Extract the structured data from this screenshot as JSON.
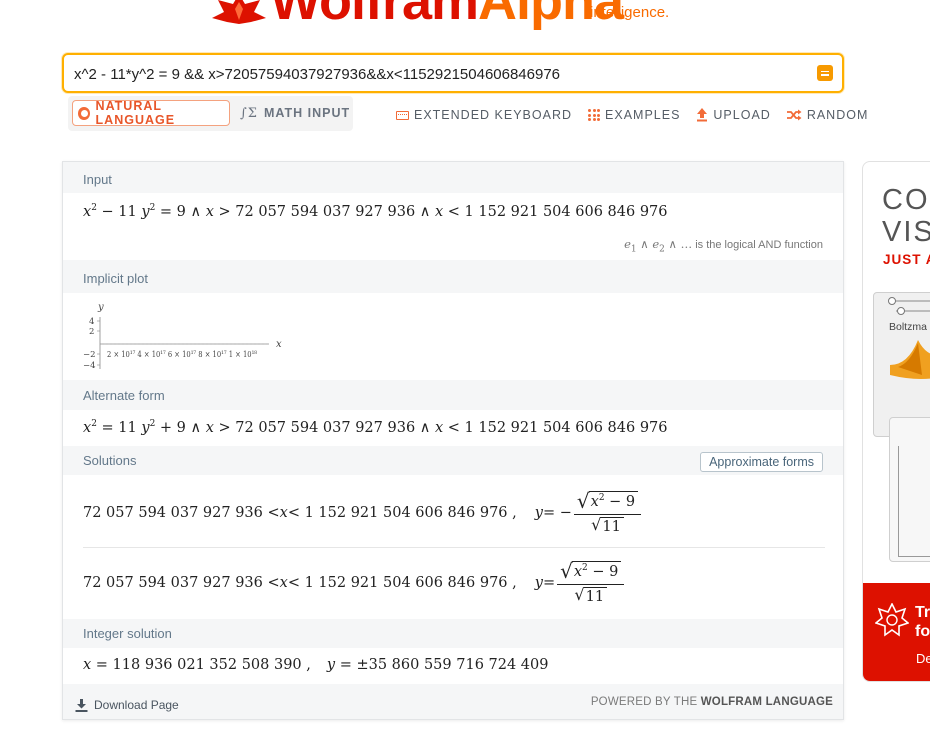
{
  "logo": {
    "word_part1": "Wolfram",
    "word_part2": "Alpha",
    "tagline": "intelligence."
  },
  "search": {
    "value": "x^2 - 11*y^2 = 9 && x>72057594037927936&&x<1152921504606846976"
  },
  "modes": {
    "natural": "NATURAL LANGUAGE",
    "math": "MATH INPUT",
    "math_icon": "∫Σ"
  },
  "tools": {
    "keyboard": "EXTENDED KEYBOARD",
    "examples": "EXAMPLES",
    "upload": "UPLOAD",
    "random": "RANDOM"
  },
  "pods": {
    "input": {
      "title": "Input",
      "lhs": "x",
      "mid": " − 11 ",
      "y": "y",
      "rest": " = 9 ∧ ",
      "x2": "x",
      "gt": " > 72 057 594 037 927 936 ∧ ",
      "x3": "x",
      "lt": " < 1 152 921 504 606 846 976",
      "note_e1": "e",
      "note_s1": "1",
      "note_and": " ∧ ",
      "note_e2": "e",
      "note_s2": "2",
      "note_rest": " ∧ …",
      "note_text": " is the logical AND function"
    },
    "plot": {
      "title": "Implicit plot",
      "y_label": "y",
      "x_label": "x",
      "y_ticks": [
        "4",
        "2",
        "−2",
        "−4"
      ],
      "x_ticks": "2 × 10¹⁷ 4 × 10¹⁷ 6 × 10¹⁷ 8 × 10¹⁷ 1 × 10¹⁸",
      "x_ticks_shown": "2 × 10",
      "x_sup_18": "18"
    },
    "alternate": {
      "title": "Alternate form",
      "x": "x",
      "eq": " = 11 ",
      "y": "y",
      "rest": " + 9 ∧ ",
      "x2": "x",
      "gt": " > 72 057 594 037 927 936 ∧ ",
      "x3": "x",
      "lt": " < 1 152 921 504 606 846 976"
    },
    "solutions": {
      "title": "Solutions",
      "approx_button": "Approximate forms",
      "range_left": "72 057 594 037 927 936 < ",
      "range_x": "x",
      "range_right": " < 1 152 921 504 606 846 976 ,",
      "y": "y",
      "eq_neg": " = −",
      "eq_pos": " = ",
      "num_x": "x",
      "num_rest": " − 9",
      "den": "11"
    },
    "integer": {
      "title": "Integer solution",
      "x": "x",
      "x_val": " = 118 936 021 352 508 390 ,",
      "y": "y",
      "y_val": " = ±35 860 559 716 724 409"
    }
  },
  "footer": {
    "download": "Download Page",
    "powered_prefix": "POWERED BY THE ",
    "powered_brand": "WOLFRAM LANGUAGE"
  },
  "ad": {
    "headline_l1": "COM",
    "headline_l2": "VIS",
    "subhead": "JUST A",
    "card_label": "Boltzma",
    "red_title_l1": "Tr",
    "red_title_l2": "fo",
    "red_desc": "De"
  },
  "colors": {
    "brand_orange": "#f96b00",
    "brand_red": "#dd1100",
    "accent": "#f26b38",
    "search_border": "#ffb000"
  }
}
